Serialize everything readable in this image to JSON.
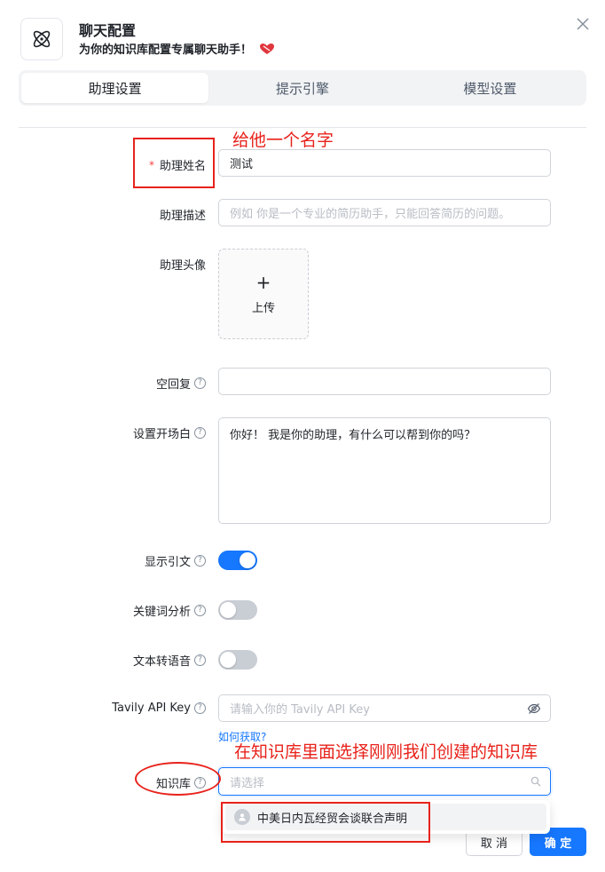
{
  "header": {
    "title": "聊天配置",
    "subtitle": "为你的知识库配置专属聊天助手！"
  },
  "tabs": [
    "助理设置",
    "提示引擎",
    "模型设置"
  ],
  "form": {
    "name": {
      "label": "助理姓名",
      "required_mark": "*",
      "value": "测试"
    },
    "description": {
      "label": "助理描述",
      "placeholder": "例如 你是一个专业的简历助手，只能回答简历的问题。"
    },
    "avatar": {
      "label": "助理头像",
      "plus": "+",
      "upload_text": "上传"
    },
    "empty_reply": {
      "label": "空回复",
      "value": ""
    },
    "opener": {
      "label": "设置开场白",
      "value": "你好！ 我是你的助理，有什么可以帮到你的吗？"
    },
    "show_quote": {
      "label": "显示引文",
      "on": true
    },
    "keyword_analysis": {
      "label": "关键词分析",
      "on": false
    },
    "tts": {
      "label": "文本转语音",
      "on": false
    },
    "tavily": {
      "label": "Tavily API Key",
      "placeholder": "请输入你的 Tavily API Key",
      "link": "如何获取?"
    },
    "knowledge_base": {
      "label": "知识库",
      "placeholder": "请选择"
    }
  },
  "help_mark": "?",
  "dropdown": {
    "options": [
      "中美日内瓦经贸会谈联合声明"
    ]
  },
  "buttons": {
    "cancel": "取 消",
    "ok": "确 定"
  },
  "annotations": {
    "name_hint": "给他一个名字",
    "kb_hint": "在知识库里面选择刚刚我们创建的知识库"
  },
  "colors": {
    "accent": "#1677ff",
    "annotation": "#e8221b",
    "heart": "#e0373f"
  },
  "icons": [
    "atom-icon",
    "heart-icon",
    "close-icon",
    "help-icon",
    "eye-off-icon",
    "search-icon",
    "user-icon"
  ]
}
